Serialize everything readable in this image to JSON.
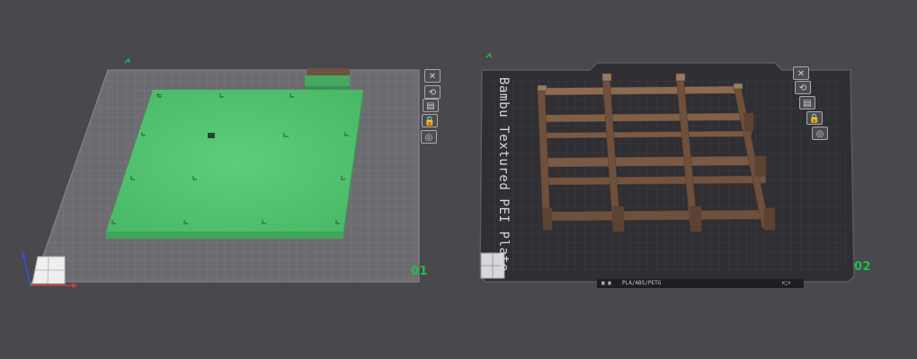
{
  "plates": [
    {
      "number": "01",
      "toolbar": [
        {
          "name": "close-plate-icon",
          "glyph": "✕"
        },
        {
          "name": "orient-icon",
          "glyph": "⟲"
        },
        {
          "name": "arrange-icon",
          "glyph": "▤"
        },
        {
          "name": "lock-icon",
          "glyph": "🔒"
        },
        {
          "name": "settings-icon",
          "glyph": "◎"
        }
      ]
    },
    {
      "number": "02",
      "bed_label": "Bambu Textured PEI Plate",
      "filament_info": "PLA/ABS/PETG",
      "toolbar": [
        {
          "name": "close-plate-icon",
          "glyph": "✕"
        },
        {
          "name": "orient-icon",
          "glyph": "⟲"
        },
        {
          "name": "arrange-icon",
          "glyph": "▤"
        },
        {
          "name": "lock-icon",
          "glyph": "🔒"
        },
        {
          "name": "settings-icon",
          "glyph": "◎"
        }
      ]
    }
  ],
  "colors": {
    "background": "#48484d",
    "plate1_bed": "#6c6c70",
    "plate2_bed": "#2e2e33",
    "model_green": "#4fc16d",
    "model_brown": "#7a5a44",
    "accent_green": "#1fbf4a"
  }
}
